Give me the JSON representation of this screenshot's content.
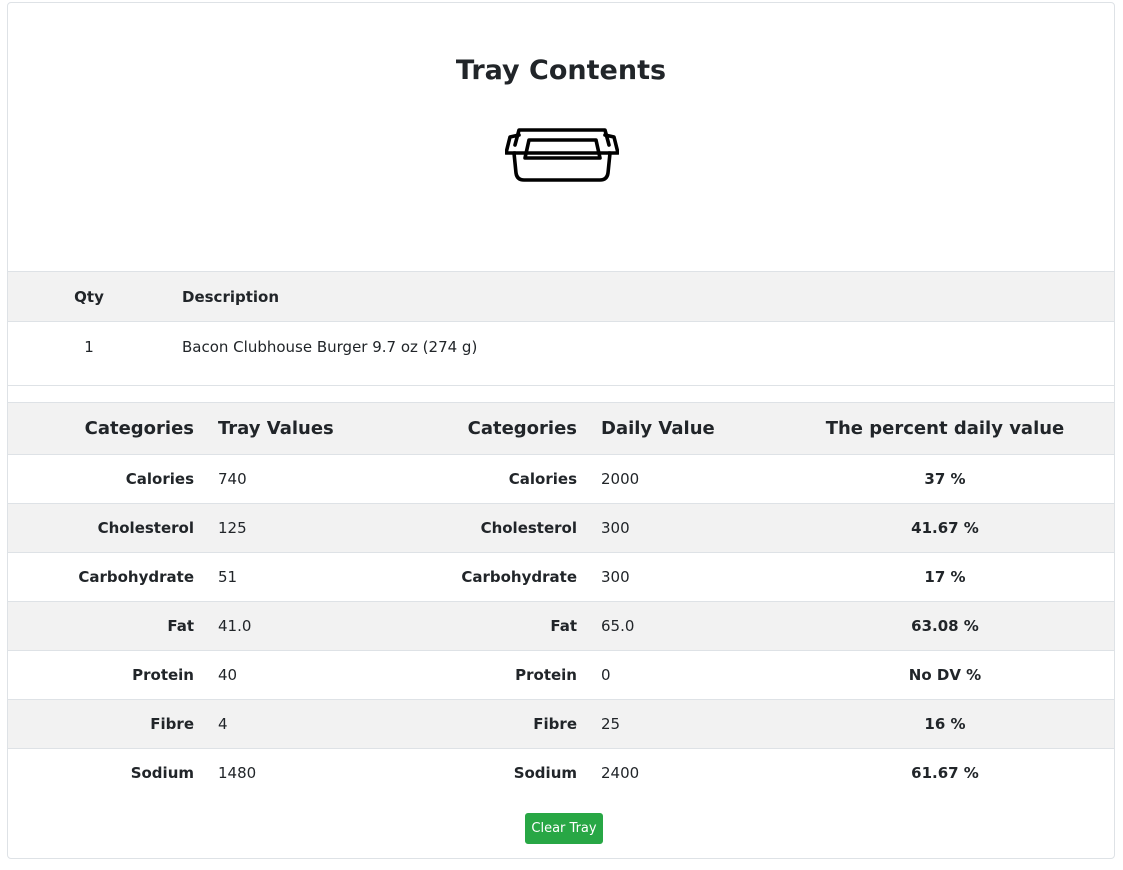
{
  "page": {
    "title": "Tray Contents",
    "icon": "baking-tray-icon"
  },
  "items_table": {
    "headers": {
      "qty": "Qty",
      "description": "Description"
    },
    "rows": [
      {
        "qty": "1",
        "description": "Bacon Clubhouse Burger 9.7 oz (274 g)"
      }
    ]
  },
  "nutrition_table": {
    "headers": {
      "categories_1": "Categories",
      "tray_values": "Tray Values",
      "categories_2": "Categories",
      "daily_value": "Daily Value",
      "percent_daily_value": "The percent daily value"
    },
    "rows": [
      {
        "category": "Calories",
        "tray_value": "740",
        "category2": "Calories",
        "daily_value": "2000",
        "percent": "37 %"
      },
      {
        "category": "Cholesterol",
        "tray_value": "125",
        "category2": "Cholesterol",
        "daily_value": "300",
        "percent": "41.67 %"
      },
      {
        "category": "Carbohydrate",
        "tray_value": "51",
        "category2": "Carbohydrate",
        "daily_value": "300",
        "percent": "17 %"
      },
      {
        "category": "Fat",
        "tray_value": "41.0",
        "category2": "Fat",
        "daily_value": "65.0",
        "percent": "63.08 %"
      },
      {
        "category": "Protein",
        "tray_value": "40",
        "category2": "Protein",
        "daily_value": "0",
        "percent": "No DV %"
      },
      {
        "category": "Fibre",
        "tray_value": "4",
        "category2": "Fibre",
        "daily_value": "25",
        "percent": "16 %"
      },
      {
        "category": "Sodium",
        "tray_value": "1480",
        "category2": "Sodium",
        "daily_value": "2400",
        "percent": "61.67 %"
      }
    ]
  },
  "actions": {
    "clear_label": "Clear Tray"
  },
  "colors": {
    "button_bg": "#28a745",
    "stripe": "#f2f2f2",
    "border": "#dee2e6"
  }
}
